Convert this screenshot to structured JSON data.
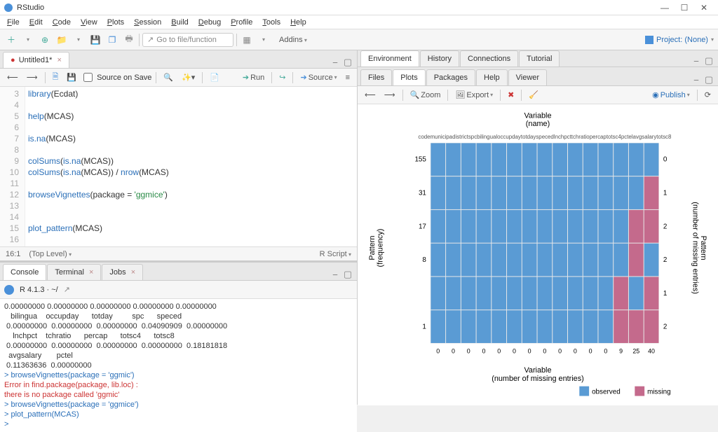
{
  "window": {
    "title": "RStudio"
  },
  "menubar": [
    "File",
    "Edit",
    "Code",
    "View",
    "Plots",
    "Session",
    "Build",
    "Debug",
    "Profile",
    "Tools",
    "Help"
  ],
  "toolbar": {
    "goto_placeholder": "Go to file/function",
    "addins": "Addins",
    "project": "Project: (None)"
  },
  "source": {
    "tab": "Untitled1*",
    "source_on_save": "Source on Save",
    "run": "Run",
    "source_btn": "Source",
    "status_pos": "16:1",
    "status_scope": "(Top Level)",
    "status_lang": "R Script",
    "lines": [
      {
        "n": 3,
        "t": "library(Ecdat)"
      },
      {
        "n": 4,
        "t": ""
      },
      {
        "n": 5,
        "t": "help(MCAS)"
      },
      {
        "n": 6,
        "t": ""
      },
      {
        "n": 7,
        "t": "is.na(MCAS)"
      },
      {
        "n": 8,
        "t": ""
      },
      {
        "n": 9,
        "t": "colSums(is.na(MCAS))"
      },
      {
        "n": 10,
        "t": "colSums(is.na(MCAS)) / nrow(MCAS)"
      },
      {
        "n": 11,
        "t": ""
      },
      {
        "n": 12,
        "t": "browseVignettes(package = 'ggmice')"
      },
      {
        "n": 13,
        "t": ""
      },
      {
        "n": 14,
        "t": ""
      },
      {
        "n": 15,
        "t": "plot_pattern(MCAS)"
      },
      {
        "n": 16,
        "t": ""
      }
    ]
  },
  "console_tabs": [
    "Console",
    "Terminal",
    "Jobs"
  ],
  "console": {
    "header": "R 4.1.3 · ~/",
    "body_top": "0.00000000 0.00000000 0.00000000 0.00000000 0.00000000\n   bilingua    occupday      totday         spc      speced\n 0.00000000  0.00000000  0.00000000  0.04090909  0.00000000\n    lnchpct    tchratio      percap      totsc4      totsc8\n 0.00000000  0.00000000  0.00000000  0.00000000  0.18181818\n  avgsalary       pctel\n 0.11363636  0.00000000",
    "l1": "> browseVignettes(package = 'ggmic')",
    "l2": "Error in find.package(package, lib.loc) :",
    "l3": "  there is no package called 'ggmic'",
    "l4": "> browseVignettes(package = 'ggmice')",
    "l5": "> plot_pattern(MCAS)",
    "l6": "> "
  },
  "env_tabs": [
    "Environment",
    "History",
    "Connections",
    "Tutorial"
  ],
  "plot_tabs": [
    "Files",
    "Plots",
    "Packages",
    "Help",
    "Viewer"
  ],
  "plot_tools": {
    "zoom": "Zoom",
    "export": "Export",
    "publish": "Publish"
  },
  "chart_data": {
    "type": "heatmap",
    "title_top": "Variable\n(name)",
    "title_bottom": "Variable\n(number of missing entries)",
    "title_left": "Pattern\n(frequency)",
    "title_right": "Pattern\n(number of missing entries)",
    "x_top_ticks": [
      "code",
      "municipa",
      "district",
      "spc",
      "bilingual",
      "occupday",
      "totday",
      "speced",
      "lnchpct",
      "tchratio",
      "percap",
      "totsc4",
      "pctel",
      "avgsalary",
      "totsc8"
    ],
    "x_bottom_ticks": [
      0,
      0,
      0,
      0,
      0,
      0,
      0,
      0,
      0,
      0,
      0,
      0,
      9,
      25,
      40
    ],
    "y_left_ticks": [
      155,
      31,
      17,
      8,
      1
    ],
    "y_right_ticks": [
      0,
      1,
      2,
      2,
      1,
      2
    ],
    "rows": 6,
    "cols": 15,
    "legend": [
      "observed",
      "missing"
    ],
    "colors": {
      "observed": "#5a9bd4",
      "missing": "#c46a8c"
    },
    "missing_cells": [
      [
        1,
        14
      ],
      [
        2,
        13
      ],
      [
        2,
        14
      ],
      [
        3,
        13
      ],
      [
        4,
        12
      ],
      [
        4,
        14
      ],
      [
        5,
        12
      ],
      [
        5,
        13
      ],
      [
        5,
        14
      ]
    ]
  }
}
